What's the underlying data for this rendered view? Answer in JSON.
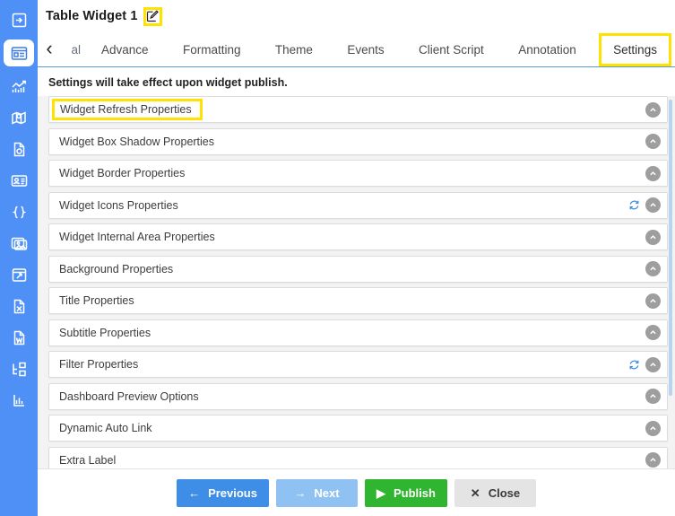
{
  "sidebar": {
    "items": [
      {
        "name": "expand-panel-icon",
        "label": "Expand",
        "active": false
      },
      {
        "name": "dashboard-icon",
        "label": "Dashboard",
        "active": true
      },
      {
        "name": "chart-icon",
        "label": "Charts",
        "active": false
      },
      {
        "name": "map-icon",
        "label": "Map",
        "active": false
      },
      {
        "name": "document-icon",
        "label": "Document",
        "active": false
      },
      {
        "name": "id-card-icon",
        "label": "Card",
        "active": false
      },
      {
        "name": "code-braces-icon",
        "label": "Code",
        "active": false
      },
      {
        "name": "image-icon",
        "label": "Image",
        "active": false
      },
      {
        "name": "window-icon",
        "label": "Window",
        "active": false
      },
      {
        "name": "excel-file-icon",
        "label": "Excel",
        "active": false
      },
      {
        "name": "word-file-icon",
        "label": "Word",
        "active": false
      },
      {
        "name": "hierarchy-icon",
        "label": "Hierarchy",
        "active": false
      },
      {
        "name": "bar-chart-icon",
        "label": "Report",
        "active": false
      }
    ]
  },
  "header": {
    "title": "Table Widget 1",
    "edit_icon": "edit-pencil-icon"
  },
  "tabs": {
    "back_chevron": "‹",
    "clipped_label": "al",
    "items": [
      {
        "label": "Advance",
        "active": false,
        "highlighted": false
      },
      {
        "label": "Formatting",
        "active": false,
        "highlighted": false
      },
      {
        "label": "Theme",
        "active": false,
        "highlighted": false
      },
      {
        "label": "Events",
        "active": false,
        "highlighted": false
      },
      {
        "label": "Client Script",
        "active": false,
        "highlighted": false
      },
      {
        "label": "Annotation",
        "active": false,
        "highlighted": false
      },
      {
        "label": "Settings",
        "active": true,
        "highlighted": true
      }
    ]
  },
  "panel": {
    "notice": "Settings will take effect upon widget publish.",
    "rows": [
      {
        "label": "Widget Refresh Properties",
        "highlighted": true,
        "has_refresh": false
      },
      {
        "label": "Widget Box Shadow Properties",
        "highlighted": false,
        "has_refresh": false
      },
      {
        "label": "Widget Border Properties",
        "highlighted": false,
        "has_refresh": false
      },
      {
        "label": "Widget Icons Properties",
        "highlighted": false,
        "has_refresh": true
      },
      {
        "label": "Widget Internal Area Properties",
        "highlighted": false,
        "has_refresh": false
      },
      {
        "label": "Background Properties",
        "highlighted": false,
        "has_refresh": false
      },
      {
        "label": "Title Properties",
        "highlighted": false,
        "has_refresh": false
      },
      {
        "label": "Subtitle Properties",
        "highlighted": false,
        "has_refresh": false
      },
      {
        "label": "Filter Properties",
        "highlighted": false,
        "has_refresh": true
      },
      {
        "label": "Dashboard Preview Options",
        "highlighted": false,
        "has_refresh": false
      },
      {
        "label": "Dynamic Auto Link",
        "highlighted": false,
        "has_refresh": false
      },
      {
        "label": "Extra Label",
        "highlighted": false,
        "has_refresh": false
      }
    ]
  },
  "footer": {
    "buttons": [
      {
        "id": "previous",
        "label": "Previous",
        "icon": "arrow-left-icon",
        "glyph": "←",
        "color": "#3e8ee8"
      },
      {
        "id": "next",
        "label": "Next",
        "icon": "arrow-right-icon",
        "glyph": "→",
        "color": "#8fc2f2"
      },
      {
        "id": "publish",
        "label": "Publish",
        "icon": "play-icon",
        "glyph": "▶",
        "color": "#2fb52f"
      },
      {
        "id": "close",
        "label": "Close",
        "icon": "close-x-icon",
        "glyph": "✕",
        "color": "#e4e4e4"
      }
    ]
  },
  "colors": {
    "sidebar_blue": "#4f90f7",
    "highlight_yellow": "#ffe200",
    "tab_underline": "#5b9bd5",
    "publish_green": "#2fb52f"
  }
}
